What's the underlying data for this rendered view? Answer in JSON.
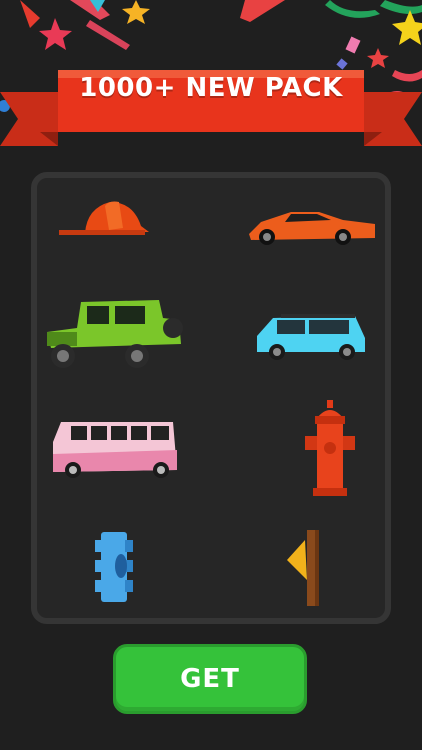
{
  "banner": {
    "title": "1000+ NEW PACK"
  },
  "items": [
    {
      "name": "firefighter-helmet-icon"
    },
    {
      "name": "orange-supercar-icon"
    },
    {
      "name": "green-jeep-icon"
    },
    {
      "name": "blue-suv-icon"
    },
    {
      "name": "pink-van-icon"
    },
    {
      "name": "fire-hydrant-icon"
    },
    {
      "name": "blue-gear-icon"
    },
    {
      "name": "yellow-arrow-sign-icon"
    }
  ],
  "button": {
    "label": "GET"
  },
  "colors": {
    "background": "#1f1f1f",
    "banner": "#e8341c",
    "button": "#35c23a"
  }
}
